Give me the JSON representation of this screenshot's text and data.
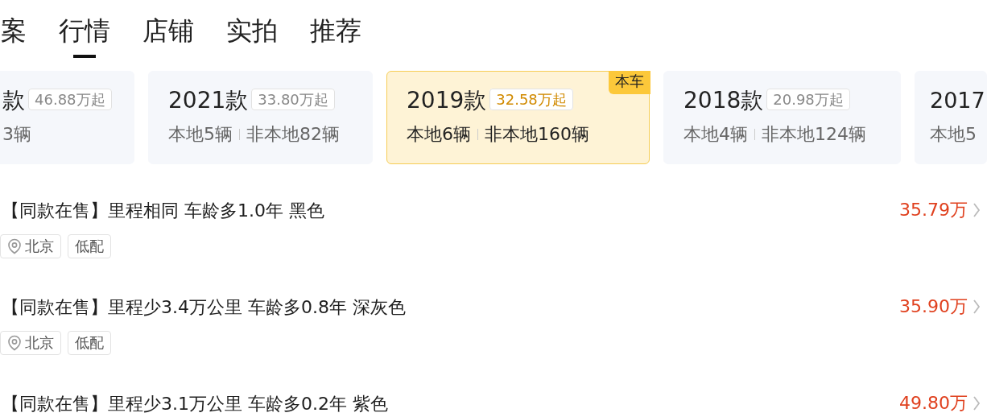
{
  "tabs": [
    {
      "label": "案",
      "selected": false
    },
    {
      "label": "行情",
      "selected": true
    },
    {
      "label": "店铺",
      "selected": false
    },
    {
      "label": "实拍",
      "selected": false
    },
    {
      "label": "推荐",
      "selected": false
    }
  ],
  "models": [
    {
      "title": "款",
      "price": "46.88万起",
      "counts": [
        "3辆"
      ],
      "selected": false
    },
    {
      "title": "2021款",
      "price": "33.80万起",
      "counts": [
        "本地5辆",
        "非本地82辆"
      ],
      "selected": false
    },
    {
      "title": "2019款",
      "price": "32.58万起",
      "counts": [
        "本地6辆",
        "非本地160辆"
      ],
      "selected": true,
      "badge": "本车"
    },
    {
      "title": "2018款",
      "price": "20.98万起",
      "counts": [
        "本地4辆",
        "非本地124辆"
      ],
      "selected": false
    },
    {
      "title": "2017",
      "counts": [
        "本地5"
      ],
      "selected": false
    }
  ],
  "listings": [
    {
      "title": "【同款在售】里程相同 车龄多1.0年 黑色",
      "price": "35.79万",
      "tags": [
        {
          "kind": "location",
          "text": "北京"
        },
        {
          "kind": "plain",
          "text": "低配"
        }
      ]
    },
    {
      "title": "【同款在售】里程少3.4万公里 车龄多0.8年 深灰色",
      "price": "35.90万",
      "tags": [
        {
          "kind": "location",
          "text": "北京"
        },
        {
          "kind": "plain",
          "text": "低配"
        }
      ]
    },
    {
      "title": "【同款在售】里程少3.1万公里 车龄多0.2年 紫色",
      "price": "49.80万"
    }
  ]
}
